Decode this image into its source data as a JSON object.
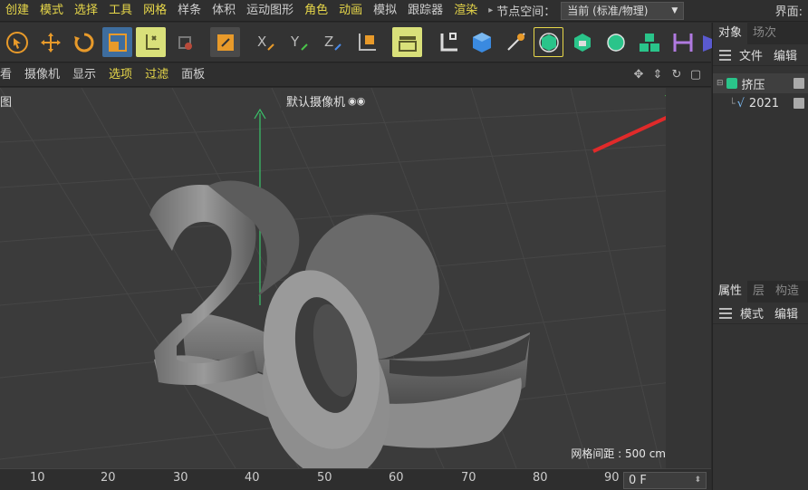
{
  "menubar": {
    "items": [
      {
        "label": "创建",
        "hl": true
      },
      {
        "label": "模式",
        "hl": true
      },
      {
        "label": "选择",
        "hl": true
      },
      {
        "label": "工具",
        "hl": true
      },
      {
        "label": "网格",
        "hl": true
      },
      {
        "label": "样条",
        "hl": false
      },
      {
        "label": "体积",
        "hl": false
      },
      {
        "label": "运动图形",
        "hl": false
      },
      {
        "label": "角色",
        "hl": true
      },
      {
        "label": "动画",
        "hl": true
      },
      {
        "label": "模拟",
        "hl": false
      },
      {
        "label": "跟踪器",
        "hl": false
      },
      {
        "label": "渲染",
        "hl": true
      }
    ],
    "node_space_label": "节点空间：",
    "node_space_value": "当前 (标准/物理)",
    "layout_label": "界面:"
  },
  "viewport_menu": {
    "items": [
      {
        "label": "看",
        "hl": false
      },
      {
        "label": "摄像机",
        "hl": false
      },
      {
        "label": "显示",
        "hl": false
      },
      {
        "label": "选项",
        "hl": true
      },
      {
        "label": "过滤",
        "hl": true
      },
      {
        "label": "面板",
        "hl": false
      }
    ]
  },
  "viewport": {
    "corner_label": "图",
    "camera_label": "默认摄像机",
    "grid_spacing": "网格间距 : 500 cm",
    "axis_y": "Y",
    "axis_z": "Z",
    "axis_x": "X"
  },
  "timeline": {
    "ticks": [
      "10",
      "20",
      "30",
      "40",
      "50",
      "60",
      "70",
      "80",
      "90"
    ],
    "frame": "0 F"
  },
  "objects_panel": {
    "tabs": [
      {
        "label": "对象",
        "on": true
      },
      {
        "label": "场次",
        "on": false
      }
    ],
    "sub": [
      "文件",
      "编辑"
    ],
    "objects": [
      {
        "name": "挤压",
        "selected": true
      },
      {
        "name": "2021",
        "selected": false
      }
    ]
  },
  "attributes_panel": {
    "tabs": [
      {
        "label": "属性",
        "on": true
      },
      {
        "label": "层",
        "on": false
      },
      {
        "label": "构造",
        "on": false
      }
    ],
    "sub": [
      "模式",
      "编辑"
    ]
  },
  "colors": {
    "menu_highlight": "#e8d84a",
    "active_tool": "#3e6d9e",
    "arrow": "#e02a2a"
  }
}
